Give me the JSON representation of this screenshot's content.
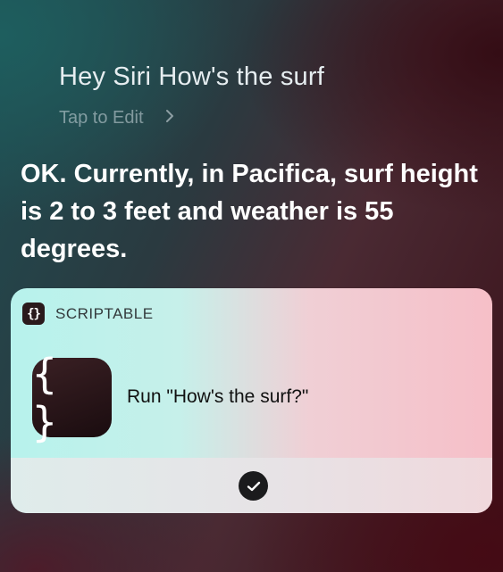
{
  "siri": {
    "query": "Hey Siri How's the surf",
    "tap_to_edit": "Tap to Edit",
    "response": "OK. Currently, in Pacifica, surf height is 2 to 3 feet and weather is 55 degrees."
  },
  "card": {
    "app_name": "SCRIPTABLE",
    "small_icon_glyph": "{}",
    "big_icon_glyph": "{ }",
    "action_label": "Run \"How's the surf?\"",
    "icons": {
      "app": "scriptable-icon",
      "status": "checkmark-circle-icon",
      "chevron": "chevron-right-icon"
    }
  }
}
